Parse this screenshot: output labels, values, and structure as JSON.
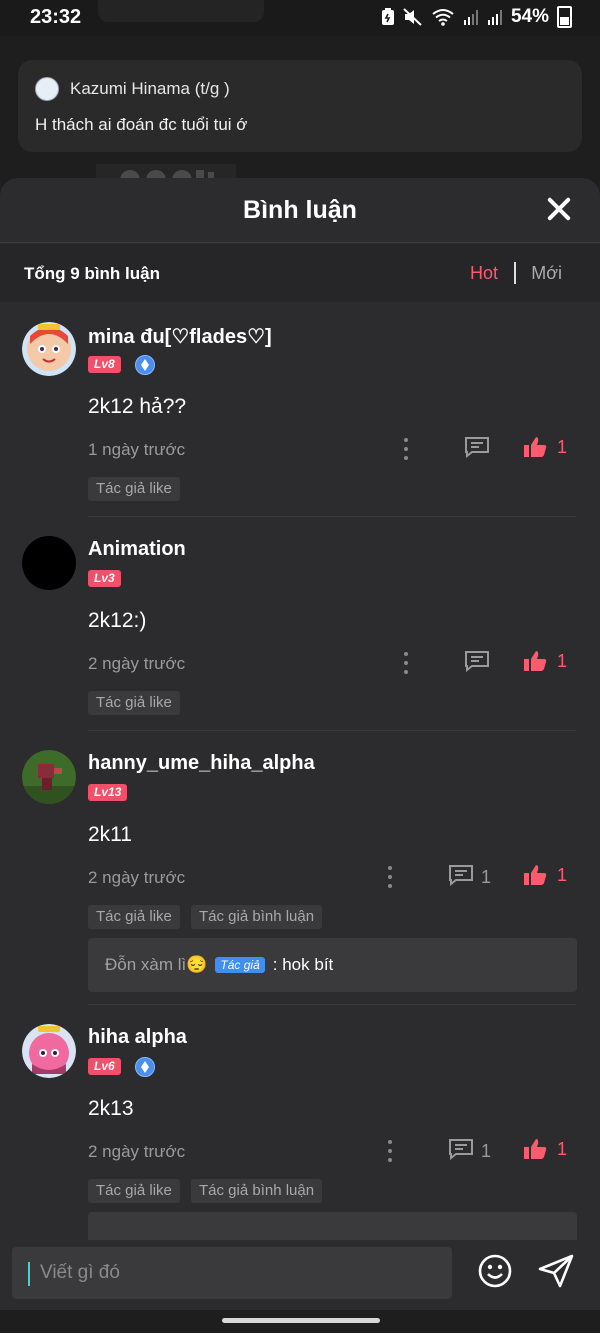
{
  "status_bar": {
    "time": "23:32",
    "battery": "54%"
  },
  "background_post": {
    "notification": {
      "author": "Kazumi Hinama (t/g )",
      "text": "H thách ai đoán đc tuổi tui ớ"
    }
  },
  "sheet": {
    "title": "Bình luận",
    "total_label": "Tổng 9 bình luận",
    "tabs": {
      "hot": "Hot",
      "new": "Mới"
    }
  },
  "comments": [
    {
      "name": "mina đu[♡flades♡]",
      "level": "Lv8",
      "text": "2k12 hả??",
      "time": "1 ngày trước",
      "replies": "",
      "likes": "1",
      "tags": [
        "Tác giả like"
      ]
    },
    {
      "name": "Animation",
      "level": "Lv3",
      "text": "2k12:)",
      "time": "2 ngày trước",
      "replies": "",
      "likes": "1",
      "tags": [
        "Tác giả like"
      ]
    },
    {
      "name": "hanny_ume_hiha_alpha",
      "level": "Lv13",
      "text": "2k11",
      "time": "2 ngày trước",
      "replies": "1",
      "likes": "1",
      "tags": [
        "Tác giả like",
        "Tác giả bình luận"
      ],
      "reply": {
        "author": "Đỗn xàm lì😔",
        "badge": "Tác giả",
        "text": ": hok bít"
      }
    },
    {
      "name": "hiha alpha",
      "level": "Lv6",
      "text": "2k13",
      "time": "2 ngày trước",
      "replies": "1",
      "likes": "1",
      "tags": [
        "Tác giả like",
        "Tác giả bình luận"
      ]
    }
  ],
  "input": {
    "placeholder": "Viết gì đó"
  },
  "colors": {
    "accent": "#ff5a6e",
    "level_badge": "#f0506a",
    "author_badge": "#3f8ef0",
    "sheet_bg": "#2c2c2e"
  }
}
